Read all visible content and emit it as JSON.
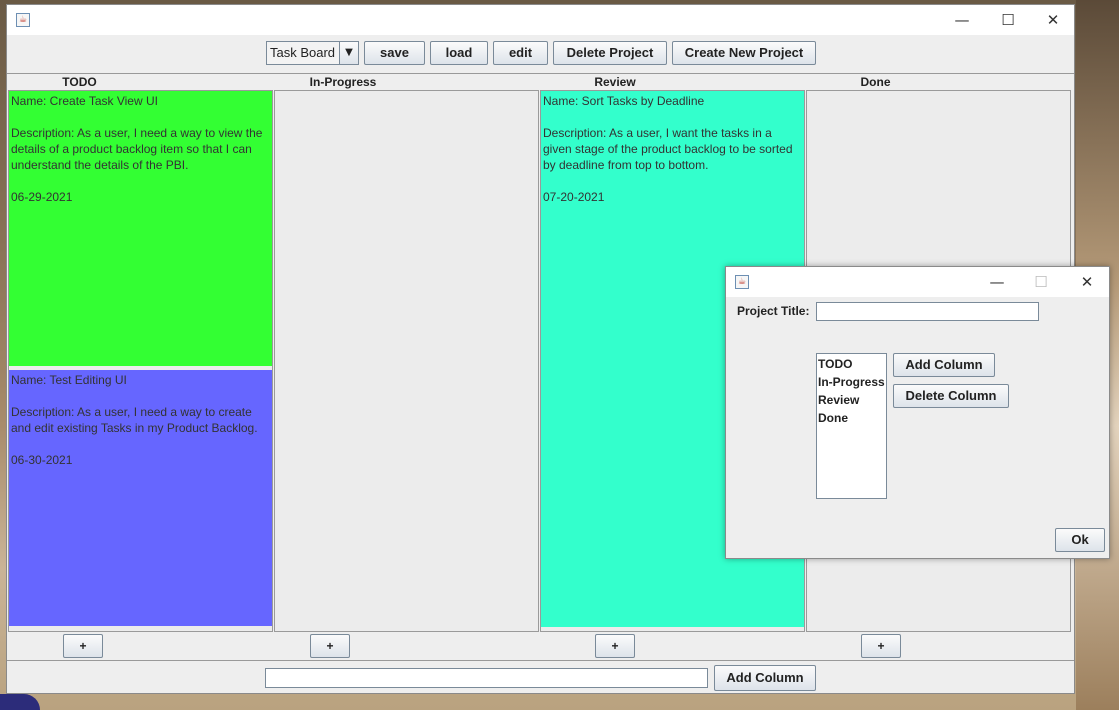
{
  "main_window": {
    "title": "",
    "controls": {
      "minimize": "—",
      "maximize": "☐",
      "close": "✕"
    },
    "toolbar": {
      "view_select": "Task Board",
      "save": "save",
      "load": "load",
      "edit": "edit",
      "delete_project": "Delete Project",
      "create_project": "Create New Project"
    },
    "columns": [
      {
        "name": "TODO",
        "cards": [
          {
            "name": "Name: Create Task View UI",
            "description": "Description: As a user, I need a way to view the details of a product backlog item so that I can understand the details of the PBI.",
            "date": "06-29-2021",
            "color": "#33ff33"
          },
          {
            "name": "Name: Test Editing UI",
            "description": "Description: As a user, I need a way to create and edit existing Tasks in my Product Backlog.",
            "date": "06-30-2021",
            "color": "#6666ff"
          }
        ]
      },
      {
        "name": "In-Progress",
        "cards": []
      },
      {
        "name": "Review",
        "cards": [
          {
            "name": "Name: Sort Tasks by Deadline",
            "description": "Description: As a user, I want the tasks in a given stage of the product backlog to be sorted by deadline from top to bottom.",
            "date": "07-20-2021",
            "color": "#33ffcc"
          }
        ]
      },
      {
        "name": "Done",
        "cards": []
      }
    ],
    "add_task_label": "+",
    "bottom": {
      "column_input_value": "",
      "add_column": "Add Column"
    }
  },
  "dialog": {
    "controls": {
      "minimize": "—",
      "maximize": "☐",
      "close": "✕"
    },
    "project_title_label": "Project Title:",
    "project_title_value": "",
    "column_list": [
      "TODO",
      "In-Progress",
      "Review",
      "Done"
    ],
    "add_column": "Add Column",
    "delete_column": "Delete Column",
    "ok": "Ok"
  }
}
